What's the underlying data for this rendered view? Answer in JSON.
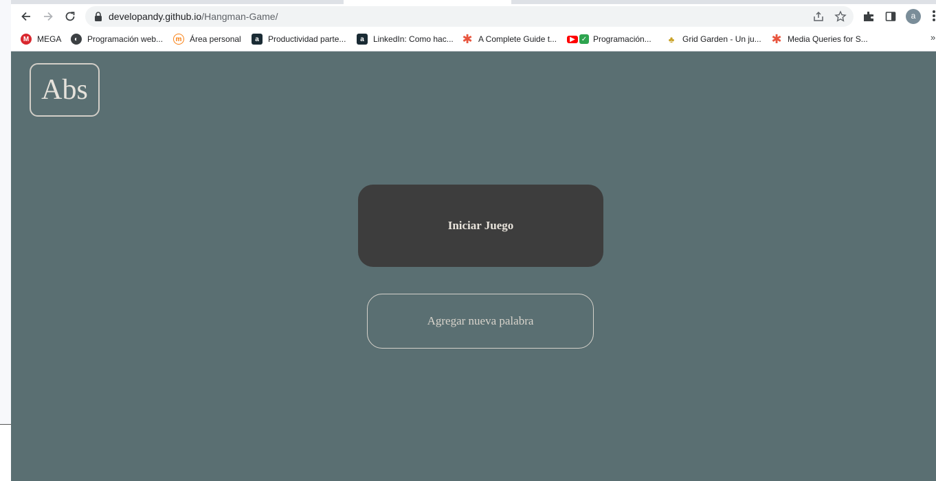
{
  "browser": {
    "url_host": "developandy.github.io",
    "url_path": "/Hangman-Game/",
    "profile_initial": "a",
    "bookmarks": [
      {
        "label": "MEGA",
        "icon": "mega-icon",
        "color": "#d9272e"
      },
      {
        "label": "Programación web...",
        "icon": "globe-icon",
        "color": "#3c4043"
      },
      {
        "label": "Área personal",
        "icon": "moodle-icon",
        "color": "#f98012"
      },
      {
        "label": "Productividad parte...",
        "icon": "a-icon",
        "color": "#1a2b34"
      },
      {
        "label": "LinkedIn: Como hac...",
        "icon": "a-icon",
        "color": "#1a2b34"
      },
      {
        "label": "A Complete Guide t...",
        "icon": "asterisk-icon",
        "color": "#e8553e"
      },
      {
        "label": "Programación...",
        "icon": "youtube-check-icon",
        "color": "#ff0000"
      },
      {
        "label": "Grid Garden - Un ju...",
        "icon": "carrot-icon",
        "color": "#c9a227"
      },
      {
        "label": "Media Queries for S...",
        "icon": "asterisk-icon",
        "color": "#e8553e"
      }
    ],
    "more_label": "»"
  },
  "page": {
    "logo_text": "Abs",
    "start_button": "Iniciar Juego",
    "add_word_button": "Agregar nueva palabra",
    "background_color": "#5a6f72",
    "start_button_color": "#3d3d3d"
  }
}
